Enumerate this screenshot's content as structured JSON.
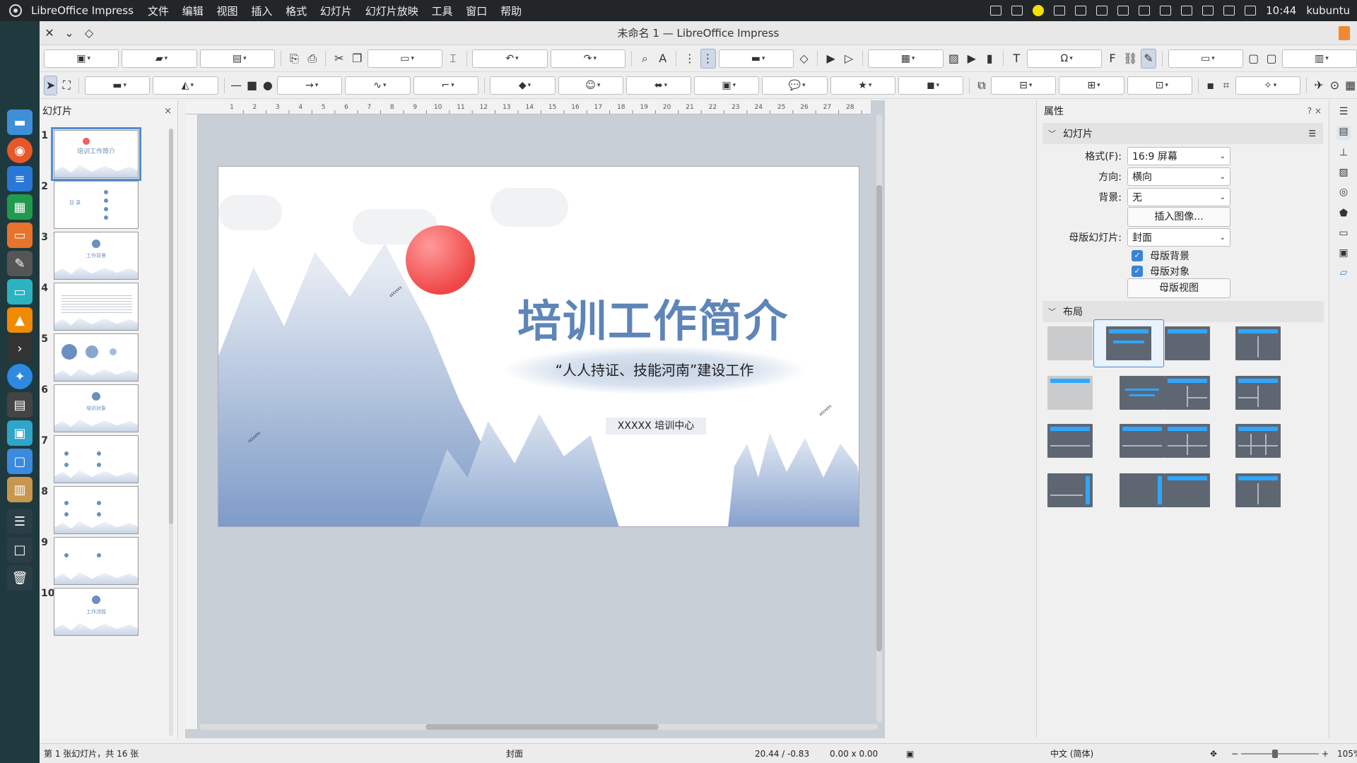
{
  "top_panel": {
    "app_name": "LibreOffice Impress",
    "menu": [
      "文件",
      "编辑",
      "视图",
      "插入",
      "格式",
      "幻灯片",
      "幻灯片放映",
      "工具",
      "窗口",
      "帮助"
    ],
    "clock": "10:44",
    "user": "kubuntu"
  },
  "window": {
    "title": "未命名 1 — LibreOffice Impress"
  },
  "slide_panel": {
    "header": "幻灯片",
    "close_glyph": "×",
    "thumbnails": [
      {
        "num": "1",
        "label": "培训工作简介"
      },
      {
        "num": "2",
        "label": "目 录"
      },
      {
        "num": "3",
        "label": "工作背景"
      },
      {
        "num": "4",
        "label": ""
      },
      {
        "num": "5",
        "label": ""
      },
      {
        "num": "6",
        "label": "培训对象"
      },
      {
        "num": "7",
        "label": ""
      },
      {
        "num": "8",
        "label": ""
      },
      {
        "num": "9",
        "label": ""
      },
      {
        "num": "10",
        "label": "工作流程"
      }
    ]
  },
  "ruler": {
    "h_ticks": [
      "1",
      "2",
      "3",
      "4",
      "5",
      "6",
      "7",
      "8",
      "9",
      "10",
      "11",
      "12",
      "13",
      "14",
      "15",
      "16",
      "17",
      "18",
      "19",
      "20",
      "21",
      "22",
      "23",
      "24",
      "25",
      "26",
      "27",
      "28"
    ]
  },
  "slide": {
    "title": "培训工作简介",
    "subtitle": "“人人持证、技能河南”建设工作",
    "org": "XXXXX 培训中心",
    "birds_glyphs": "‹‹‹‹‹‹‹"
  },
  "properties": {
    "header": "属性",
    "header_controls": "?  ×",
    "section_slide": "幻灯片",
    "format_label": "格式(F):",
    "format_value": "16:9 屏幕",
    "orientation_label": "方向:",
    "orientation_value": "横向",
    "background_label": "背景:",
    "background_value": "无",
    "insert_image_button": "插入图像...",
    "master_slide_label": "母版幻灯片:",
    "master_slide_value": "封面",
    "master_background": "母版背景",
    "master_objects": "母版对象",
    "master_view_button": "母版视图",
    "section_layout": "布局"
  },
  "status": {
    "slide_info": "第 1 张幻灯片，共 16 张",
    "master": "封面",
    "position": "20.44 / -0.83",
    "size": "0.00 x 0.00",
    "language": "中文 (简体)",
    "zoom": "105%"
  },
  "colors": {
    "title_blue": "#5d85b8",
    "sun_red": "#f04848",
    "layout_accent": "#2fa6ff",
    "selection_blue": "#4f8ed1"
  }
}
